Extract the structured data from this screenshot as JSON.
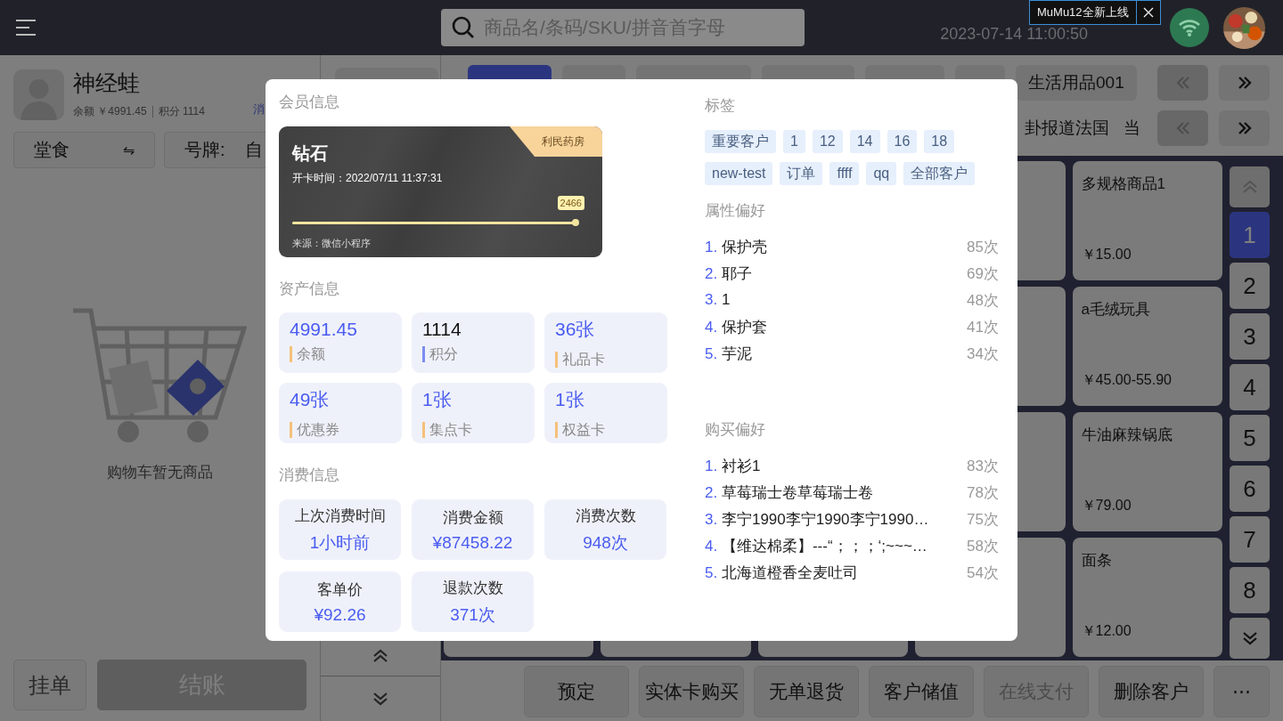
{
  "top_bar": {
    "search": {
      "placeholder": "商品名/条码/SKU/拼音首字母"
    },
    "datetime": "2023-07-14 11:00:50",
    "notice": {
      "text": "MuMu12全新上线"
    }
  },
  "member": {
    "name": "神经蛙",
    "balance": "余额 ￥4991.45",
    "points": "积分 1114",
    "link": "消"
  },
  "dine_mode": {
    "label": "堂食",
    "switch": "⇋"
  },
  "plate": {
    "label": "号牌:",
    "value": "自"
  },
  "cart": {
    "empty_text": "购物车暂无商品"
  },
  "cart_actions": [
    {
      "label": "挂单",
      "kind": "secondary"
    },
    {
      "label": "结账",
      "kind": "primary"
    }
  ],
  "categories_row1": [
    {
      "selected": true
    },
    {
      "selected": false
    },
    {
      "selected": false
    },
    {
      "selected": false
    },
    {
      "selected": false
    },
    {
      "selected": false
    },
    {
      "label": "生活用品001",
      "selected": false
    }
  ],
  "categories_row2": [
    {
      "label": "卦报道法国",
      "selected": false
    },
    {
      "label": "当",
      "selected": false
    }
  ],
  "products": [
    {
      "name": "多规格商品1",
      "price": "￥15.00"
    },
    {
      "name": "a毛绒玩具",
      "price": "￥45.00-55.90"
    },
    {
      "name": "牛油麻辣锅底",
      "price": "￥79.00"
    },
    {
      "name": "面条",
      "price": "￥12.00"
    }
  ],
  "pages": [
    {
      "label": "1",
      "selected": true
    },
    {
      "label": "2",
      "selected": false
    },
    {
      "label": "3",
      "selected": false
    },
    {
      "label": "4",
      "selected": false
    },
    {
      "label": "5",
      "selected": false
    },
    {
      "label": "6",
      "selected": false
    },
    {
      "label": "7",
      "selected": false
    },
    {
      "label": "8",
      "selected": false
    }
  ],
  "actions": [
    {
      "label": "预定",
      "disabled": false
    },
    {
      "label": "实体卡购买",
      "disabled": false
    },
    {
      "label": "无单退货",
      "disabled": false
    },
    {
      "label": "客户储值",
      "disabled": false
    },
    {
      "label": "在线支付",
      "disabled": true
    },
    {
      "label": "删除客户",
      "disabled": false
    },
    {
      "label": "⋯",
      "disabled": false
    }
  ],
  "modal": {
    "member_title": "会员信息",
    "member_card": {
      "level_name": "钻石",
      "store": "利民药房",
      "opened": "开卡时间：2022/07/11 11:37:31",
      "level": 1,
      "reading": "2466",
      "source": "来源：微信小程序"
    },
    "assets_title": "资产信息",
    "assets": [
      {
        "value": "4991.45",
        "label": "余额",
        "kind": "money"
      },
      {
        "value": "1114",
        "label": "积分",
        "kind": "points"
      },
      {
        "value": "36张",
        "label": "礼品卡",
        "kind": "card"
      },
      {
        "value": "49张",
        "label": "优惠券",
        "kind": "card"
      },
      {
        "value": "1张",
        "label": "集点卡",
        "kind": "card"
      },
      {
        "value": "1张",
        "label": "权益卡",
        "kind": "card"
      }
    ],
    "spend_title": "消费信息",
    "spend": [
      {
        "label": "上次消费时间",
        "value": "1小时前"
      },
      {
        "label": "消费金额",
        "value": "¥87458.22"
      },
      {
        "label": "消费次数",
        "value": "948次"
      },
      {
        "label": "客单价",
        "value": "¥92.26"
      },
      {
        "label": "退款次数",
        "value": "371次"
      }
    ],
    "tags_title": "标签",
    "tags": [
      "重要客户",
      "1",
      "12",
      "14",
      "16",
      "18",
      "new-test",
      "订单",
      "ffff",
      "qq",
      "全部客户"
    ],
    "attribute_title": "属性偏好",
    "attribute_prefs": [
      {
        "rank": "1.",
        "name": "保护壳",
        "count": "85次"
      },
      {
        "rank": "2.",
        "name": "耶子",
        "count": "69次"
      },
      {
        "rank": "3.",
        "name": "1",
        "count": "48次"
      },
      {
        "rank": "4.",
        "name": "保护套",
        "count": "41次"
      },
      {
        "rank": "5.",
        "name": "芋泥",
        "count": "34次"
      }
    ],
    "purchase_title": "购买偏好",
    "purchase_prefs": [
      {
        "rank": "1.",
        "name": "衬衫1",
        "count": "83次"
      },
      {
        "rank": "2.",
        "name": "草莓瑞士卷草莓瑞士卷",
        "count": "78次"
      },
      {
        "rank": "3.",
        "name": "李宁1990李宁1990李宁1990…",
        "count": "75次"
      },
      {
        "rank": "4.",
        "name": "【维达棉柔】---“；；；‘;~~~…",
        "count": "58次"
      },
      {
        "rank": "5.",
        "name": "北海道橙香全麦吐司",
        "count": "54次"
      }
    ]
  }
}
